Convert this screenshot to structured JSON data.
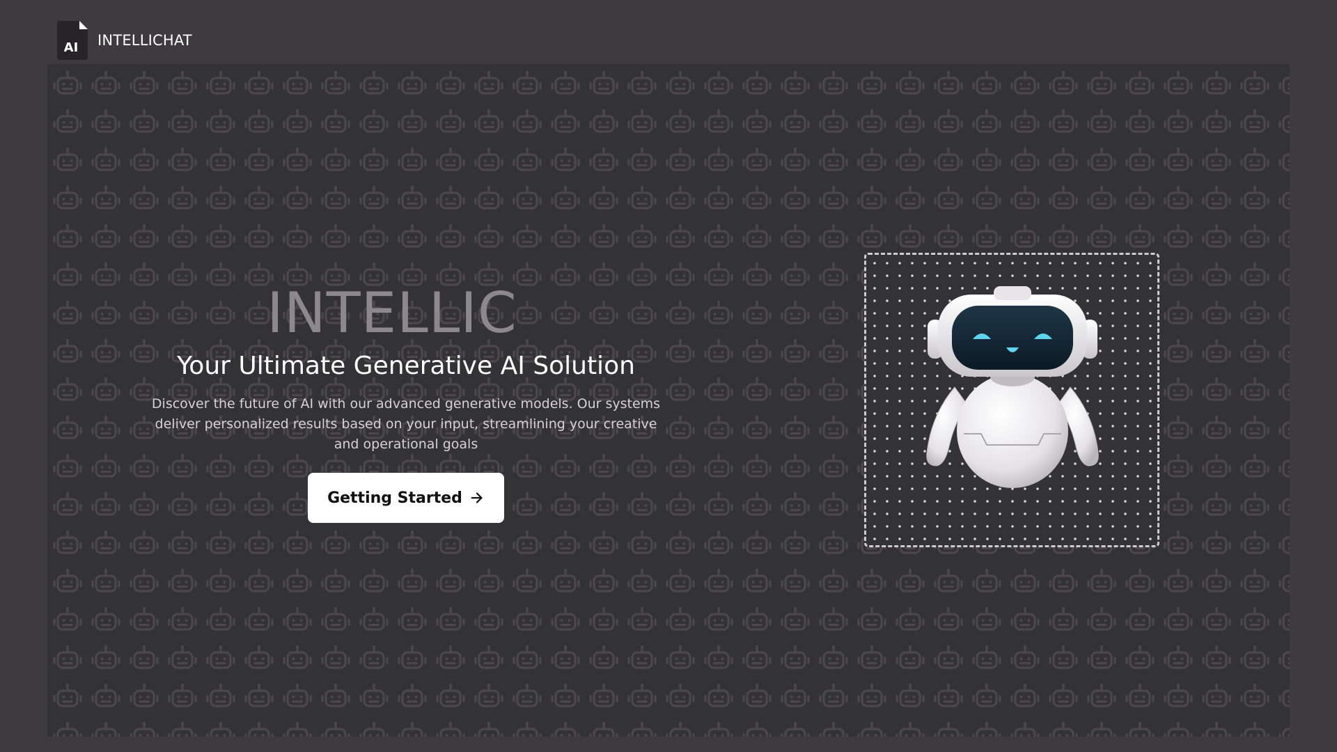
{
  "header": {
    "logo_text": "AI",
    "brand_name": "INTELLICHAT"
  },
  "hero": {
    "title": "INTELLIC",
    "subtitle": "Your Ultimate Generative AI Solution",
    "description": "Discover the future of AI with our advanced generative models. Our systems deliver personalized results based on your input, streamlining your creative and operational goals",
    "cta_label": "Getting Started",
    "cta_icon": "arrow-right-icon"
  },
  "background": {
    "pattern_icon": "robot-head-icon"
  },
  "colors": {
    "page_bg": "#3e3b3e",
    "hero_bg": "#333235",
    "title_gray": "#8c898c",
    "button_bg": "#ffffff",
    "robot_eye": "#5fd4ee"
  }
}
